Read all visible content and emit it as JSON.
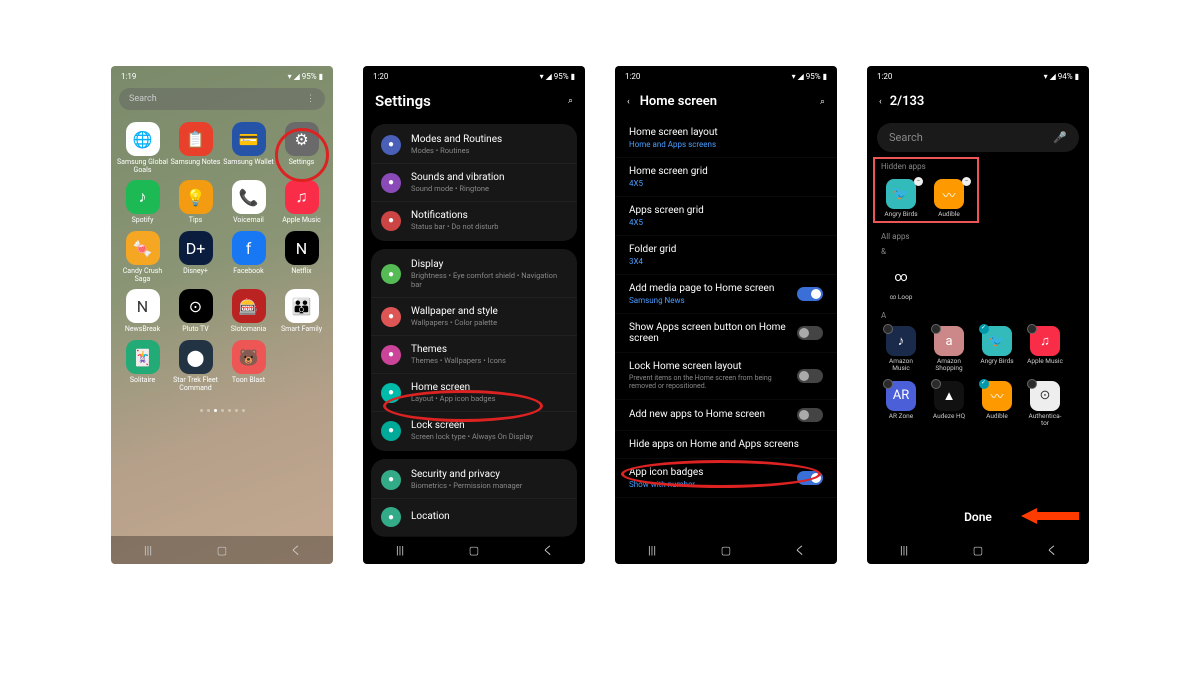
{
  "phone1": {
    "time": "1:19",
    "battery": "95%",
    "search_placeholder": "Search",
    "apps": [
      {
        "label": "Samsung Global Goals",
        "bg": "#fff",
        "glyph": "🌐"
      },
      {
        "label": "Samsung Notes",
        "bg": "#e8402b",
        "glyph": "📋"
      },
      {
        "label": "Samsung Wallet",
        "bg": "#2553a8",
        "glyph": "💳"
      },
      {
        "label": "Settings",
        "bg": "#6a6a6a",
        "glyph": "⚙"
      },
      {
        "label": "Spotify",
        "bg": "#1db954",
        "glyph": "♪"
      },
      {
        "label": "Tips",
        "bg": "#f39c12",
        "glyph": "💡"
      },
      {
        "label": "Voicemail",
        "bg": "#fff",
        "glyph": "📞"
      },
      {
        "label": "Apple Music",
        "bg": "#fa2d48",
        "glyph": "♫"
      },
      {
        "label": "Candy Crush Saga",
        "bg": "#f5a623",
        "glyph": "🍬"
      },
      {
        "label": "Disney+",
        "bg": "#0b1d3e",
        "glyph": "D+"
      },
      {
        "label": "Facebook",
        "bg": "#1877f2",
        "glyph": "f"
      },
      {
        "label": "Netflix",
        "bg": "#000",
        "glyph": "N"
      },
      {
        "label": "NewsBreak",
        "bg": "#fff",
        "glyph": "N"
      },
      {
        "label": "Pluto TV",
        "bg": "#000",
        "glyph": "⊙"
      },
      {
        "label": "Slotomania",
        "bg": "#b22",
        "glyph": "🎰"
      },
      {
        "label": "Smart Family",
        "bg": "#fff",
        "glyph": "👪"
      },
      {
        "label": "Solitaire",
        "bg": "#2a7",
        "glyph": "🃏"
      },
      {
        "label": "Star Trek Fleet Command",
        "bg": "#234",
        "glyph": "⬤"
      },
      {
        "label": "Toon Blast",
        "bg": "#e55",
        "glyph": "🐻"
      }
    ]
  },
  "phone2": {
    "time": "1:20",
    "battery": "95%",
    "title": "Settings",
    "groups": [
      [
        {
          "title": "Modes and Routines",
          "sub": "Modes • Routines",
          "color": "#4a5fb8"
        },
        {
          "title": "Sounds and vibration",
          "sub": "Sound mode • Ringtone",
          "color": "#8a4ab8"
        },
        {
          "title": "Notifications",
          "sub": "Status bar • Do not disturb",
          "color": "#c44"
        }
      ],
      [
        {
          "title": "Display",
          "sub": "Brightness • Eye comfort shield • Navigation bar",
          "color": "#5b5"
        },
        {
          "title": "Wallpaper and style",
          "sub": "Wallpapers • Color palette",
          "color": "#d55"
        },
        {
          "title": "Themes",
          "sub": "Themes • Wallpapers • Icons",
          "color": "#c49"
        },
        {
          "title": "Home screen",
          "sub": "Layout • App icon badges",
          "color": "#0ba"
        },
        {
          "title": "Lock screen",
          "sub": "Screen lock type • Always On Display",
          "color": "#0a9"
        }
      ],
      [
        {
          "title": "Security and privacy",
          "sub": "Biometrics • Permission manager",
          "color": "#3a8"
        },
        {
          "title": "Location",
          "sub": "",
          "color": "#3a8"
        }
      ]
    ]
  },
  "phone3": {
    "time": "1:20",
    "battery": "95%",
    "title": "Home screen",
    "items": [
      {
        "label": "Home screen layout",
        "sub": "Home and Apps screens"
      },
      {
        "label": "Home screen grid",
        "sub": "4X5"
      },
      {
        "label": "Apps screen grid",
        "sub": "4X5"
      },
      {
        "label": "Folder grid",
        "sub": "3X4"
      }
    ],
    "toggles": [
      {
        "label": "Add media page to Home screen",
        "sub": "Samsung News",
        "on": true
      },
      {
        "label": "Show Apps screen button on Home screen",
        "on": false
      },
      {
        "label": "Lock Home screen layout",
        "desc": "Prevent items on the Home screen from being removed or repositioned.",
        "on": false
      },
      {
        "label": "Add new apps to Home screen",
        "on": false
      },
      {
        "label": "Hide apps on Home and Apps screens",
        "plain": true
      },
      {
        "label": "App icon badges",
        "sub": "Show with number",
        "on": true
      }
    ]
  },
  "phone4": {
    "time": "1:20",
    "battery": "94%",
    "count": "2/133",
    "search_placeholder": "Search",
    "hidden_label": "Hidden apps",
    "hidden_apps": [
      {
        "label": "Angry Birds",
        "bg": "#3bb",
        "glyph": "🐦"
      },
      {
        "label": "Audible",
        "bg": "#f90",
        "glyph": "〰"
      }
    ],
    "allapps_label": "All apps",
    "sections": [
      {
        "letter": "&",
        "apps": [
          {
            "label": "∞ Loop",
            "bg": "#000",
            "glyph": "∞"
          }
        ]
      },
      {
        "letter": "A",
        "apps": [
          {
            "label": "Amazon Music",
            "bg": "#1a2a4a",
            "glyph": "♪",
            "checked": false
          },
          {
            "label": "Amazon Shopping",
            "bg": "#c88",
            "glyph": "a",
            "checked": false
          },
          {
            "label": "Angry Birds",
            "bg": "#3bb",
            "glyph": "🐦",
            "checked": true
          },
          {
            "label": "Apple Music",
            "bg": "#fa2d48",
            "glyph": "♫",
            "checked": false
          },
          {
            "label": "AR Zone",
            "bg": "#4a5fd8",
            "glyph": "AR",
            "checked": false
          },
          {
            "label": "Audeze HQ",
            "bg": "#111",
            "glyph": "▲",
            "checked": false
          },
          {
            "label": "Audible",
            "bg": "#f90",
            "glyph": "〰",
            "checked": true
          },
          {
            "label": "Authentica-tor",
            "bg": "#eee",
            "glyph": "⊙",
            "checked": false
          }
        ]
      }
    ],
    "done_label": "Done"
  }
}
